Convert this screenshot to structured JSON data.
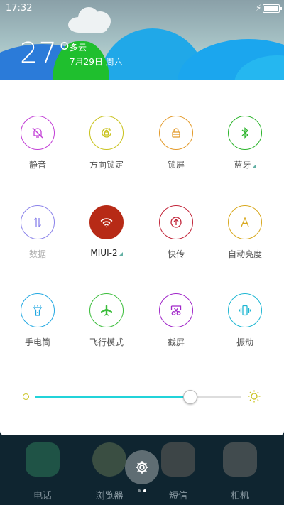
{
  "status_bar": {
    "time": "17:32"
  },
  "weather": {
    "temperature": "27°",
    "condition": "多云",
    "date": "7月29日 周六"
  },
  "toggles": [
    {
      "label": "静音",
      "icon": "bell-off-icon",
      "color": "#c23fd6",
      "active": false
    },
    {
      "label": "方向锁定",
      "icon": "rotation-lock-icon",
      "color": "#c9c21d",
      "active": false
    },
    {
      "label": "锁屏",
      "icon": "lock-icon",
      "color": "#e39a2a",
      "active": false
    },
    {
      "label": "蓝牙",
      "icon": "bluetooth-icon",
      "color": "#2db52d",
      "active": false,
      "expandable": true
    },
    {
      "label": "数据",
      "icon": "mobile-data-icon",
      "color": "#8a82ea",
      "active": false,
      "disabled": true
    },
    {
      "label": "MIUI-2",
      "icon": "wifi-icon",
      "color": "#b72a16",
      "active": true,
      "expandable": true
    },
    {
      "label": "快传",
      "icon": "share-upload-icon",
      "color": "#c2263a",
      "active": false
    },
    {
      "label": "自动亮度",
      "icon": "auto-brightness-icon",
      "color": "#d8a81e",
      "active": false
    },
    {
      "label": "手电筒",
      "icon": "flashlight-icon",
      "color": "#22a8e2",
      "active": false
    },
    {
      "label": "飞行模式",
      "icon": "airplane-icon",
      "color": "#3bbd3b",
      "active": false
    },
    {
      "label": "截屏",
      "icon": "scissors-icon",
      "color": "#a127c9",
      "active": false
    },
    {
      "label": "振动",
      "icon": "vibrate-icon",
      "color": "#1fb7d3",
      "active": false
    }
  ],
  "brightness": {
    "level": 0.75
  },
  "dock": [
    {
      "label": "电话",
      "icon": "phone-icon"
    },
    {
      "label": "浏览器",
      "icon": "browser-icon"
    },
    {
      "label": "短信",
      "icon": "messages-icon"
    },
    {
      "label": "相机",
      "icon": "camera-icon"
    }
  ],
  "pager": {
    "pages": 2,
    "current": 1
  },
  "colors": {
    "accent": "#21d3d9",
    "panel": "#ffffff",
    "dock_bg": "#0f2530"
  }
}
